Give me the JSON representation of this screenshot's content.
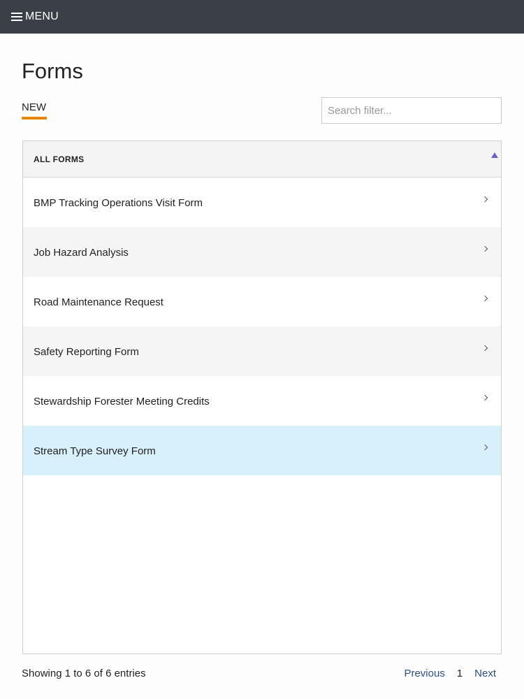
{
  "topbar": {
    "menu_label": "MENU"
  },
  "page": {
    "title": "Forms"
  },
  "tabs": [
    {
      "label": "NEW"
    }
  ],
  "search": {
    "placeholder": "Search filter...",
    "value": ""
  },
  "table": {
    "header": "ALL FORMS",
    "rows": [
      {
        "label": "BMP Tracking Operations Visit Form"
      },
      {
        "label": "Job Hazard Analysis"
      },
      {
        "label": "Road Maintenance Request"
      },
      {
        "label": "Safety Reporting Form"
      },
      {
        "label": "Stewardship Forester Meeting Credits"
      },
      {
        "label": "Stream Type Survey Form"
      }
    ]
  },
  "footer": {
    "info": "Showing 1 to 6 of 6 entries",
    "previous": "Previous",
    "page": "1",
    "next": "Next"
  },
  "colors": {
    "topbar": "#3b3f47",
    "accent_underline": "#e8870e",
    "sort_icon": "#6b63c7",
    "selected_row": "#d8effc",
    "link": "#2f4f83"
  },
  "icons": {
    "menu": "hamburger-icon",
    "sort": "sort-asc-icon",
    "row_action": "chevron-right-icon"
  }
}
